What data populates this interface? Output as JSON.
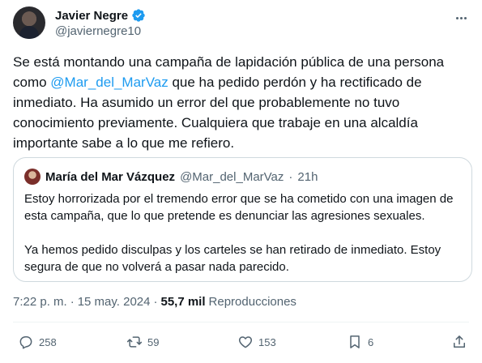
{
  "author": {
    "name": "Javier Negre",
    "handle": "@javiernegre10"
  },
  "tweet": {
    "text_before": "Se está montando una campaña de lapidación pública de una persona como ",
    "mention": "@Mar_del_MarVaz",
    "text_after": " que ha pedido perdón y ha rectificado de inmediato. Ha asumido un error del que probablemente no tuvo conocimiento previamente. Cualquiera que trabaje en una alcaldía importante sabe a lo que me refiero."
  },
  "quote": {
    "name": "María del Mar Vázquez",
    "handle": "@Mar_del_MarVaz",
    "separator": "·",
    "time": "21h",
    "paragraph1": "Estoy horrorizada por el tremendo error que se ha cometido con una imagen de esta campaña, que lo que pretende es denunciar las agresiones sexuales.",
    "paragraph2": "Ya hemos pedido disculpas y los carteles se han retirado de inmediato. Estoy segura de que no volverá a pasar nada parecido."
  },
  "meta": {
    "time": "7:22 p. m.",
    "sep": "·",
    "date": "15 may. 2024",
    "views_count": "55,7 mil",
    "views_label": "Reproducciones"
  },
  "actions": {
    "replies": "258",
    "retweets": "59",
    "likes": "153",
    "bookmarks": "6"
  },
  "colors": {
    "accent": "#1d9bf0",
    "text": "#0f1419",
    "secondary": "#536471",
    "border": "#cfd9de"
  }
}
